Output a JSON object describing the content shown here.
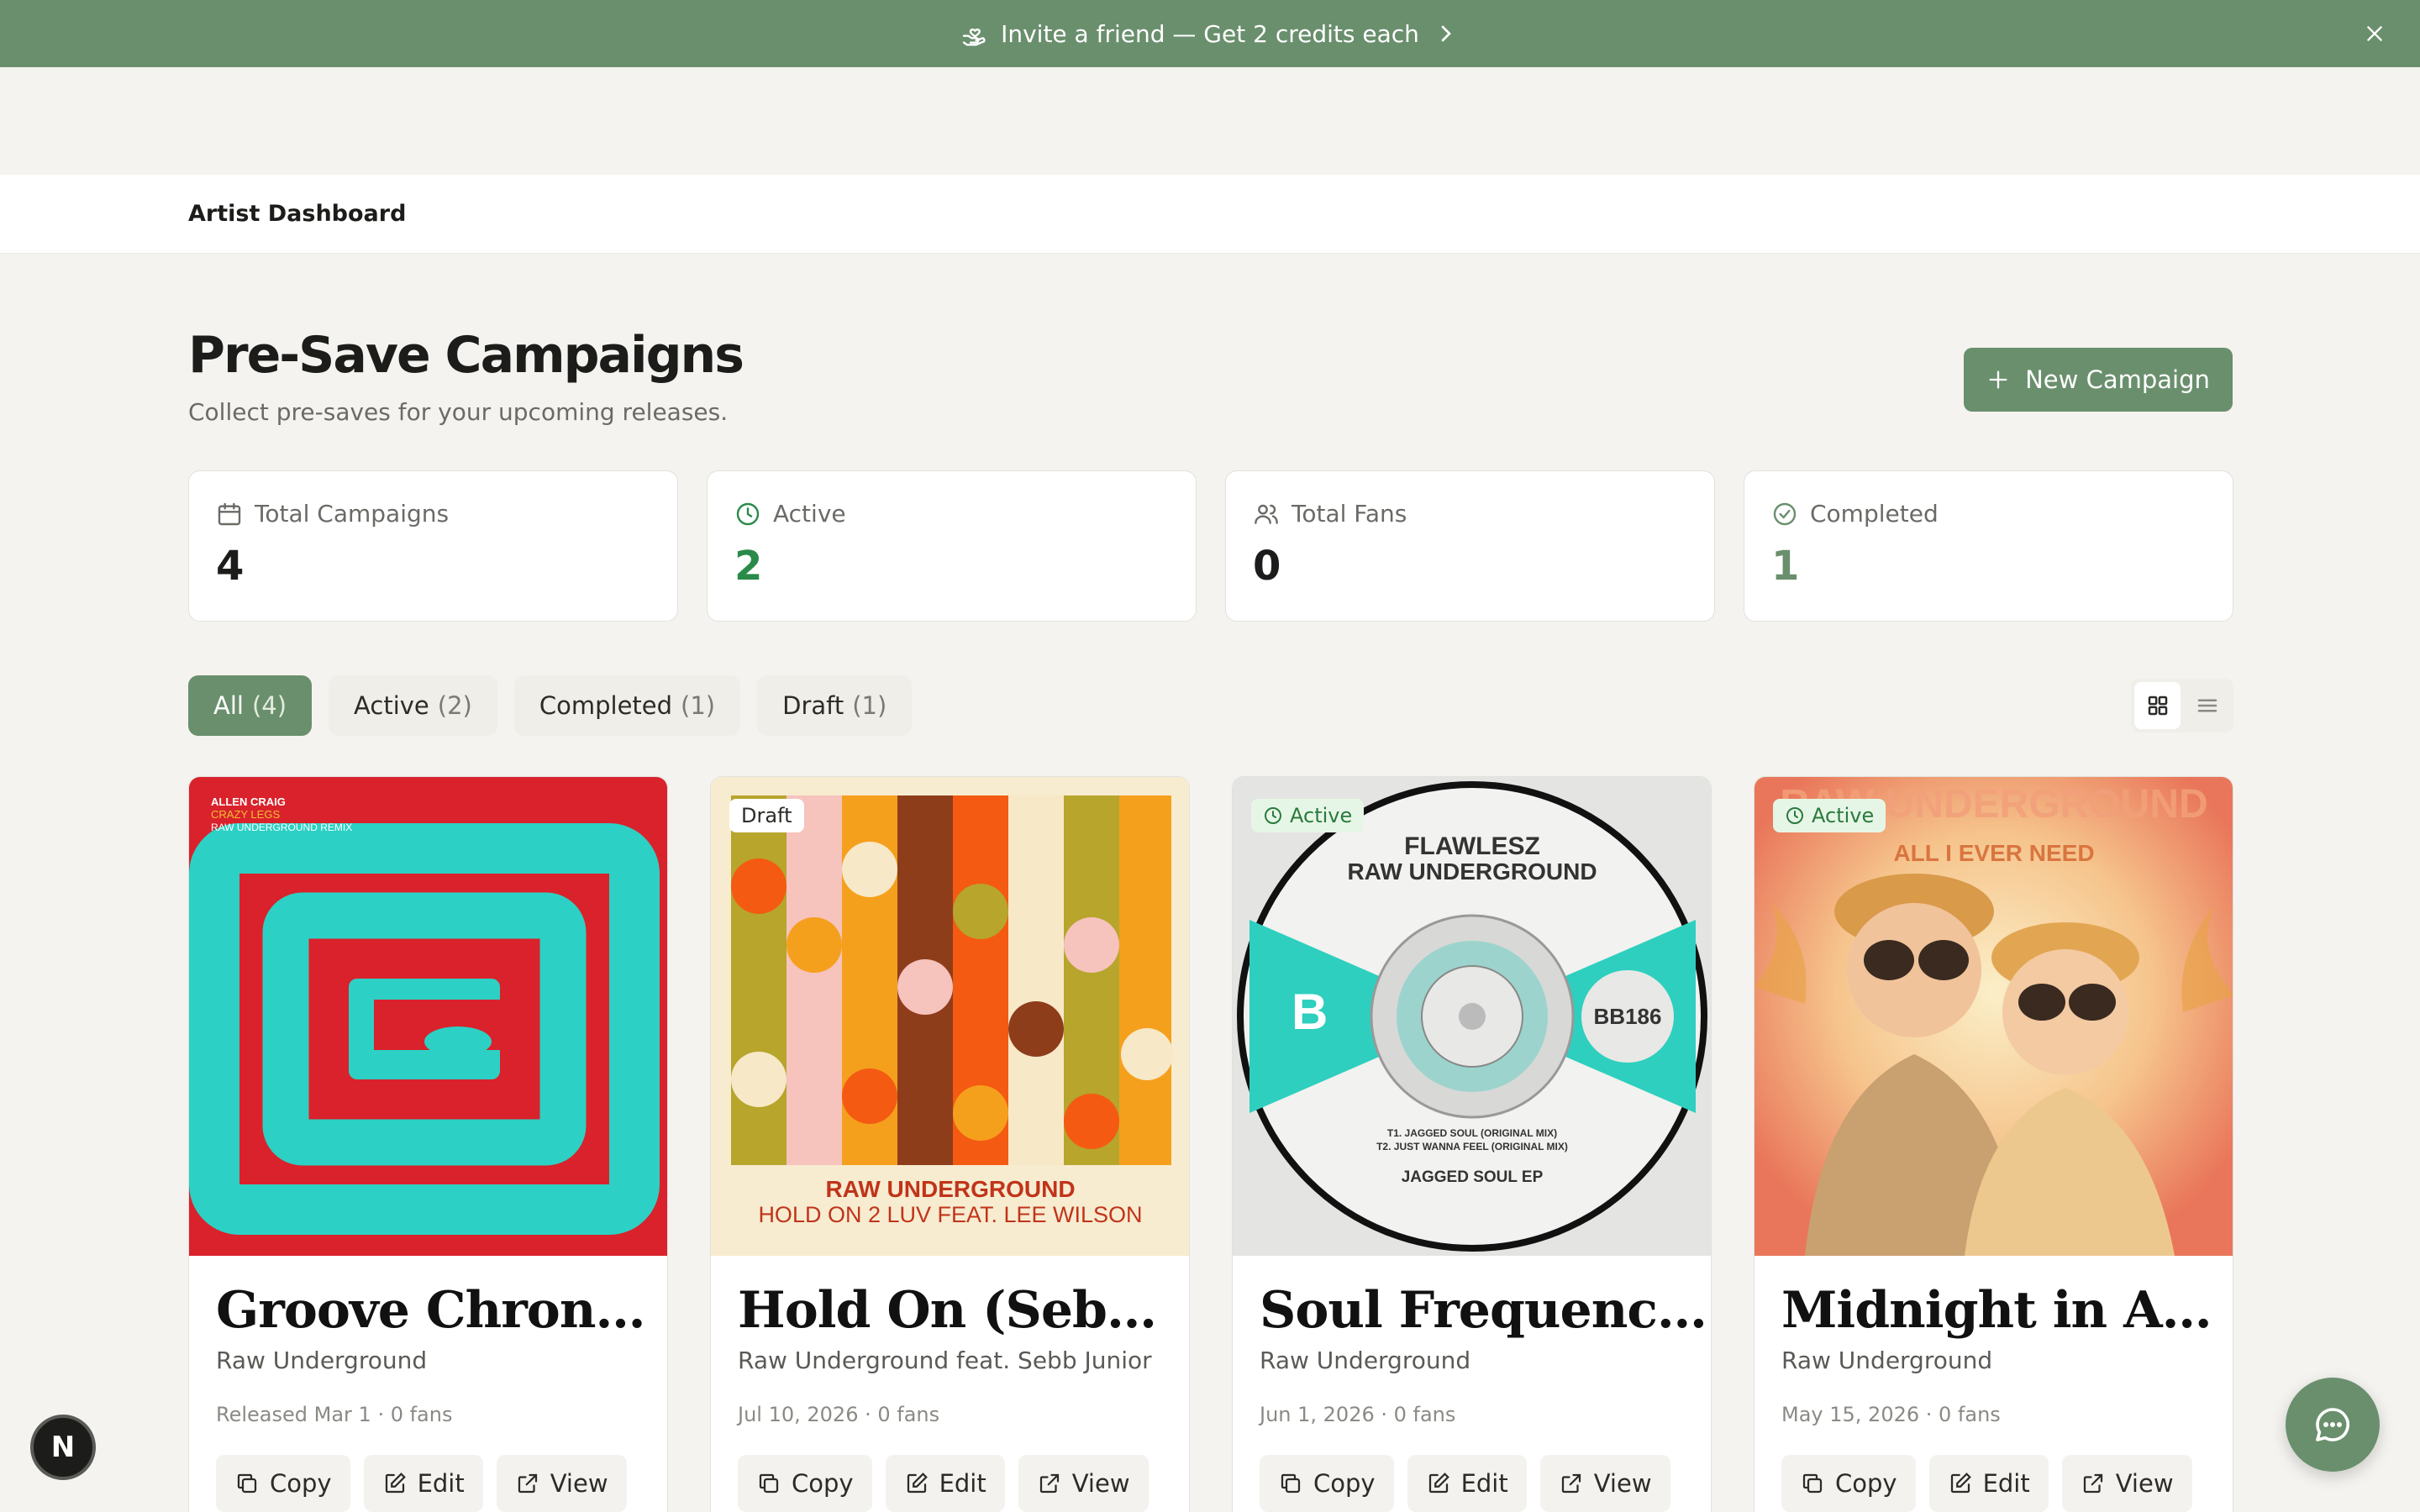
{
  "banner": {
    "text": "Invite a friend — Get 2 credits each",
    "icon": "hand-heart-icon"
  },
  "nav": {
    "title": "Artist Dashboard"
  },
  "header": {
    "title": "Pre-Save Campaigns",
    "subtitle": "Collect pre-saves for your upcoming releases.",
    "new_button": "New Campaign"
  },
  "stats": [
    {
      "label": "Total Campaigns",
      "value": "4",
      "icon": "calendar-icon"
    },
    {
      "label": "Active",
      "value": "2",
      "icon": "clock-icon"
    },
    {
      "label": "Total Fans",
      "value": "0",
      "icon": "users-icon"
    },
    {
      "label": "Completed",
      "value": "1",
      "icon": "check-circle-icon"
    }
  ],
  "tabs": [
    {
      "label": "All",
      "count": "(4)",
      "active": true
    },
    {
      "label": "Active",
      "count": "(2)"
    },
    {
      "label": "Completed",
      "count": "(1)"
    },
    {
      "label": "Draft",
      "count": "(1)"
    }
  ],
  "cards": [
    {
      "title": "Groove Chron…",
      "artist": "Raw Underground",
      "meta": "Released Mar 1 · 0 fans",
      "badge": "",
      "cover_text": {
        "line1": "ALLEN CRAIG",
        "line2": "CRAZY LEGS",
        "line3": "RAW UNDERGROUND REMIX"
      }
    },
    {
      "title": "Hold On (Seb…",
      "artist": "Raw Underground feat. Sebb Junior",
      "meta": "Jul 10, 2026 · 0 fans",
      "badge": "Draft",
      "cover_text": {
        "line1": "RAW UNDERGROUND",
        "line2": "HOLD ON 2 LUV FEAT. LEE WILSON"
      }
    },
    {
      "title": "Soul Frequenc…",
      "artist": "Raw Underground",
      "meta": "Jun 1, 2026 · 0 fans",
      "badge": "Active",
      "cover_text": {
        "line1": "FLAWLESZ",
        "line2": "RAW UNDERGROUND",
        "line3": "BB186",
        "line4": "T1. JAGGED SOUL (ORIGINAL MIX)",
        "line5": "T2. JUST WANNA FEEL (ORIGINAL MIX)",
        "line6": "JAGGED SOUL EP"
      }
    },
    {
      "title": "Midnight in A…",
      "artist": "Raw Underground",
      "meta": "May 15, 2026 · 0 fans",
      "badge": "Active",
      "cover_text": {
        "line1": "RAW UNDERGROUND",
        "line2": "ALL I EVER NEED"
      }
    }
  ],
  "actions": {
    "copy": "Copy",
    "edit": "Edit",
    "view": "View"
  },
  "floating": {
    "n_badge": "N"
  },
  "colors": {
    "accent": "#6a8f6d",
    "active_green": "#2a8a4a",
    "background": "#f4f3ef"
  }
}
